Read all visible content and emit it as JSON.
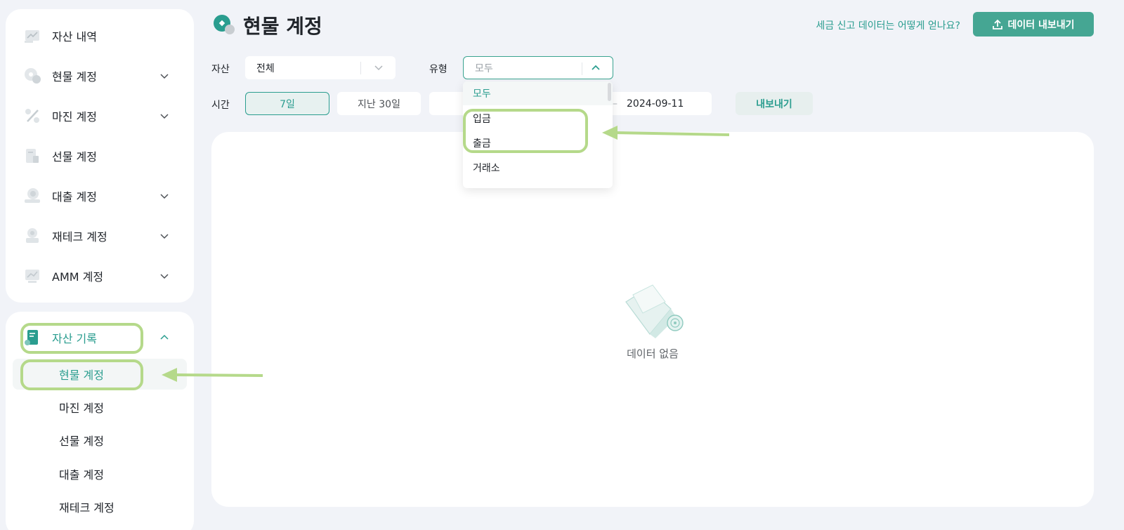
{
  "sidebar": {
    "top_items": [
      {
        "label": "자산 내역",
        "icon": "asset-history-icon",
        "chevron": false
      },
      {
        "label": "현물 계정",
        "icon": "spot-account-icon",
        "chevron": true
      },
      {
        "label": "마진 계정",
        "icon": "margin-account-icon",
        "chevron": true
      },
      {
        "label": "선물 계정",
        "icon": "futures-account-icon",
        "chevron": false
      },
      {
        "label": "대출 계정",
        "icon": "loan-account-icon",
        "chevron": true
      },
      {
        "label": "재테크 계정",
        "icon": "earn-account-icon",
        "chevron": true
      },
      {
        "label": "AMM 계정",
        "icon": "amm-account-icon",
        "chevron": true
      }
    ],
    "records": {
      "label": "자산 기록",
      "sub_items": [
        "현물 계정",
        "마진 계정",
        "선물 계정",
        "대출 계정",
        "재테크 계정"
      ],
      "active_sub": "현물 계정"
    }
  },
  "header": {
    "title": "현물 계정",
    "help_link": "세금 신고 데이터는 어떻게 얻나요?",
    "export_data_label": "데이터 내보내기"
  },
  "filters": {
    "asset_label": "자산",
    "asset_value": "전체",
    "type_label": "유형",
    "type_value": "모두",
    "time_label": "시간",
    "time_options": [
      "7일",
      "지난 30일"
    ],
    "time_selected": "7일",
    "date_end": "2024-09-11",
    "date_sep": "–",
    "export_label": "내보내기"
  },
  "type_dropdown": {
    "options": [
      "모두",
      "입금",
      "출금",
      "거래소"
    ],
    "selected": "모두"
  },
  "empty_state": {
    "label": "데이터 없음"
  },
  "colors": {
    "accent": "#2a9d8f",
    "export_button": "#45a693",
    "highlight": "#b5d98a",
    "background": "#f1f3f8"
  }
}
